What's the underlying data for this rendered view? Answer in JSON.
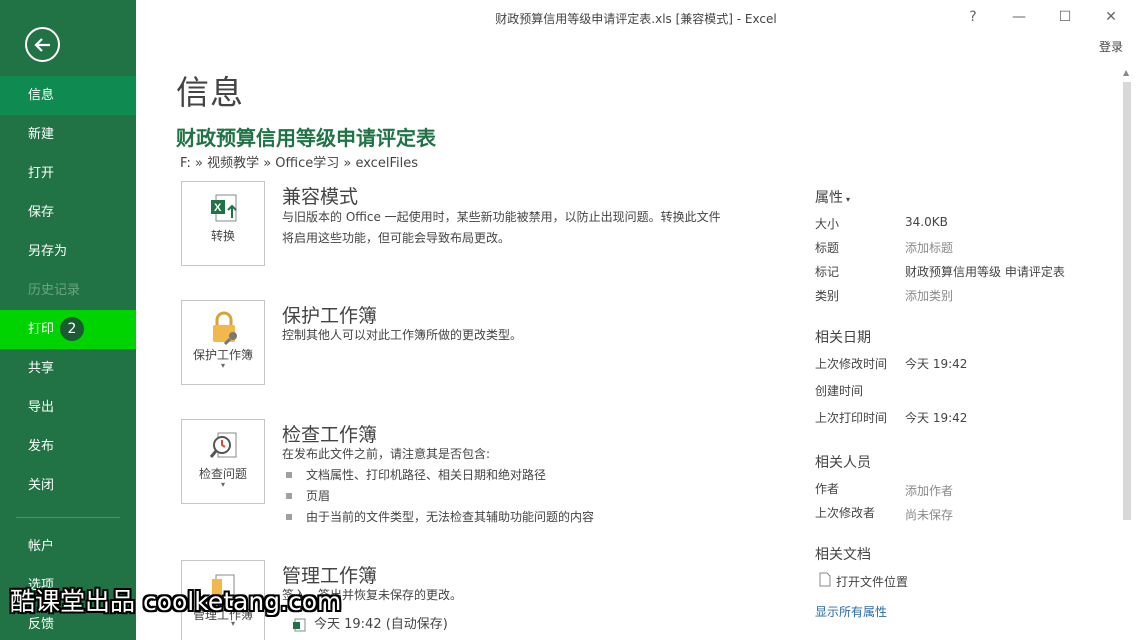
{
  "window": {
    "title": "财政预算信用等级申请评定表.xls  [兼容模式] - Excel",
    "help": "?",
    "minimize": "—",
    "maximize": "☐",
    "close": "✕",
    "signin": "登录"
  },
  "nav": {
    "items": [
      {
        "label": "信息"
      },
      {
        "label": "新建"
      },
      {
        "label": "打开"
      },
      {
        "label": "保存"
      },
      {
        "label": "另存为"
      },
      {
        "label": "历史记录"
      },
      {
        "label": "打印",
        "badge": "2"
      },
      {
        "label": "共享"
      },
      {
        "label": "导出"
      },
      {
        "label": "发布"
      },
      {
        "label": "关闭"
      },
      {
        "label": "帐户"
      },
      {
        "label": "选项"
      },
      {
        "label": "反馈"
      }
    ]
  },
  "main": {
    "page_title": "信息",
    "doc_title": "财政预算信用等级申请评定表",
    "doc_path": "F: » 视频教学 » Office学习 » excelFiles",
    "sections": [
      {
        "tile_label": "转换",
        "title": "兼容模式",
        "desc": "与旧版本的 Office 一起使用时，某些新功能被禁用，以防止出现问题。转换此文件将启用这些功能，但可能会导致布局更改。"
      },
      {
        "tile_label": "保护工作簿",
        "title": "保护工作簿",
        "desc": "控制其他人可以对此工作簿所做的更改类型。"
      },
      {
        "tile_label": "检查问题",
        "title": "检查工作簿",
        "desc": "在发布此文件之前，请注意其是否包含:",
        "bullets": [
          "文档属性、打印机路径、相关日期和绝对路径",
          "页眉",
          "由于当前的文件类型，无法检查其辅助功能问题的内容"
        ]
      },
      {
        "tile_label": "管理工作簿",
        "title": "管理工作簿",
        "desc": "签入、签出并恢复未保存的更改。",
        "version": "今天 19:42 (自动保存)"
      }
    ],
    "caret": "▾"
  },
  "properties": {
    "header": "属性",
    "rows": [
      {
        "key": "大小",
        "value": "34.0KB"
      },
      {
        "key": "标题",
        "value": "添加标题"
      },
      {
        "key": "标记",
        "value": "财政预算信用等级 申请评定表"
      },
      {
        "key": "类别",
        "value": "添加类别"
      }
    ],
    "dates_header": "相关日期",
    "dates": [
      {
        "key": "上次修改时间",
        "value": "今天 19:42"
      },
      {
        "key": "创建时间",
        "value": ""
      },
      {
        "key": "上次打印时间",
        "value": "今天 19:42"
      }
    ],
    "people_header": "相关人员",
    "people": [
      {
        "key": "作者",
        "value": "添加作者"
      },
      {
        "key": "上次修改者",
        "value": "尚未保存"
      }
    ],
    "docs_header": "相关文档",
    "open_location": "打开文件位置",
    "show_all": "显示所有属性"
  },
  "watermark": "酷课堂出品 coolketang.com",
  "colors": {
    "accent": "#217346",
    "nav_active": "#0f8b52",
    "nav_hover": "#00d400",
    "link": "#2b6ba8"
  }
}
